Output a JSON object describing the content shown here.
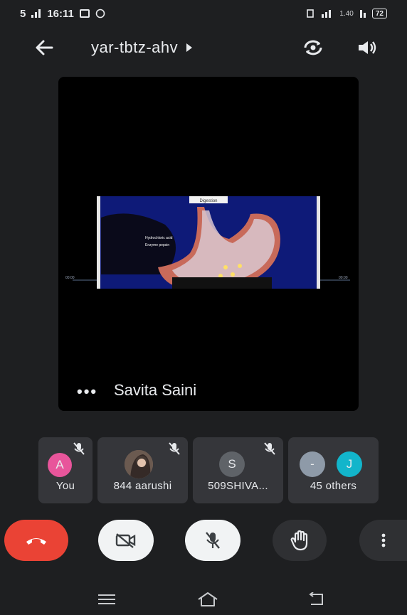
{
  "status_bar": {
    "signal_text": "5",
    "time": "16:11",
    "speed_value": "1.40",
    "battery_level": "72"
  },
  "header": {
    "meeting_code": "yar-tbtz-ahv"
  },
  "presenter": {
    "name": "Savita Saini",
    "options_label": "•••"
  },
  "shared_screen": {
    "badge_text": "Digestion",
    "label_line1": "Hydrochloric acid",
    "label_line2": "Enzyme pepsin",
    "edge_left": "00:00",
    "edge_right": "00:00"
  },
  "participants": [
    {
      "name": "You",
      "avatar_letter": "A",
      "avatar_color": "#e8559b",
      "muted": true
    },
    {
      "name": "844 aarushi",
      "avatar_letter": "",
      "avatar_color": "#8a7466",
      "muted": true
    },
    {
      "name": "509SHIVA...",
      "avatar_letter": "S",
      "avatar_color": "#5f6368",
      "muted": true
    },
    {
      "name": "45 others",
      "avatar_letter": "-",
      "avatar_letter_2": "J",
      "avatar_color": "#8e9aa8",
      "avatar_color_2": "#12b5cb",
      "muted": false
    }
  ],
  "controls": {
    "end_call_icon": "phone-hangup-icon",
    "camera_icon": "video-off-icon",
    "mic_icon": "mic-off-icon",
    "hand_icon": "raise-hand-icon",
    "more_icon": "more-vert-icon"
  },
  "colors": {
    "background": "#1e1f21",
    "tile": "#35363a",
    "end_call": "#ea4335",
    "control_light": "#f1f3f4",
    "control_dark": "#2f3033"
  }
}
